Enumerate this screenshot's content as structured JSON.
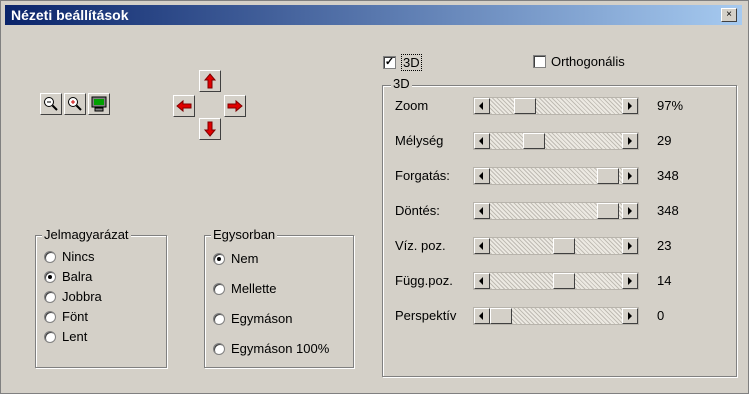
{
  "window": {
    "title": "Nézeti beállítások",
    "close_glyph": "×"
  },
  "toolbar": {
    "icons": [
      "zoom-out-icon",
      "zoom-in-icon",
      "monitor-icon",
      "arrow-left-icon",
      "arrow-up-icon",
      "arrow-down-icon",
      "arrow-right-icon"
    ]
  },
  "legend_group": {
    "title": "Jelmagyarázat",
    "options": [
      "Nincs",
      "Balra",
      "Jobbra",
      "Fönt",
      "Lent"
    ],
    "selected": "Balra"
  },
  "inline_group": {
    "title": "Egysorban",
    "options": [
      "Nem",
      "Mellette",
      "Egymáson",
      "Egymáson 100%"
    ],
    "selected": "Nem"
  },
  "checks": {
    "three_d": "3D",
    "three_d_checked": true,
    "ortho": "Orthogonális",
    "ortho_checked": false,
    "check_glyph": "✓"
  },
  "panel3d": {
    "title": "3D",
    "rows": [
      {
        "label": "Zoom",
        "value": "97%",
        "level": 0.22
      },
      {
        "label": "Mélység",
        "value": "29",
        "level": 0.3
      },
      {
        "label": "Forgatás:",
        "value": "348",
        "level": 0.97
      },
      {
        "label": "Döntés:",
        "value": "348",
        "level": 0.97
      },
      {
        "label": "Víz. poz.",
        "value": "23",
        "level": 0.57
      },
      {
        "label": "Függ.poz.",
        "value": "14",
        "level": 0.57
      },
      {
        "label": "Perspektív",
        "value": "0",
        "level": 0.0
      }
    ]
  }
}
